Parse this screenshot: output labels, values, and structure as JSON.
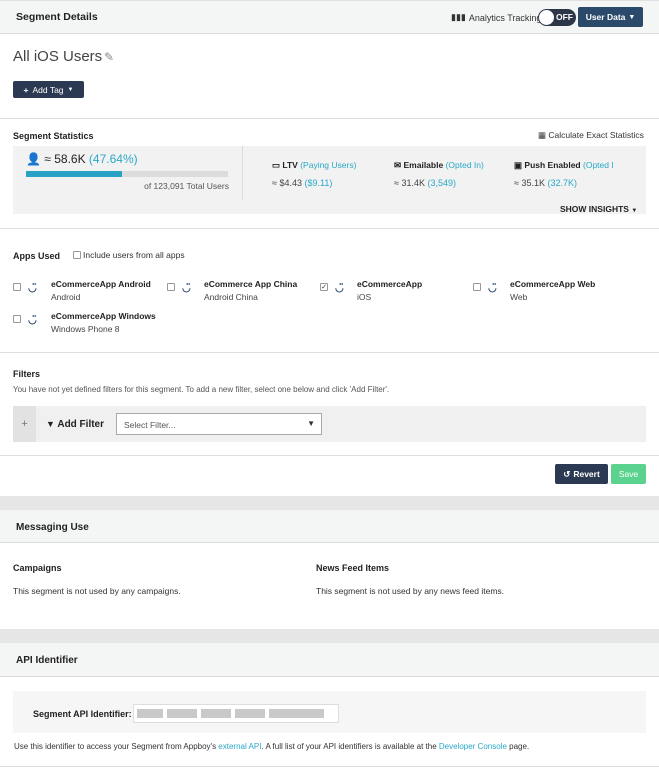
{
  "header": {
    "title": "Segment Details",
    "analytics_label": "Analytics Tracking",
    "toggle_label": "OFF",
    "user_data_label": "User Data"
  },
  "segment": {
    "name": "All iOS Users",
    "add_tag_label": "Add Tag"
  },
  "stats": {
    "title": "Segment Statistics",
    "calc_label": "Calculate Exact Statistics",
    "users_value": "≈ 58.6K",
    "users_pct": "(47.64%)",
    "users_fraction": 0.4764,
    "total_users": "of 123,091 Total Users",
    "metrics": [
      {
        "label": "LTV",
        "sub": "(Paying Users)",
        "value": "≈ $4.43",
        "value_sub": "($9.11)",
        "icon": "credit-card-icon"
      },
      {
        "label": "Emailable",
        "sub": "(Opted In)",
        "value": "≈ 31.4K",
        "value_sub": "(3,549)",
        "icon": "envelope-icon"
      },
      {
        "label": "Push Enabled",
        "sub": "(Opted I",
        "value": "≈ 35.1K",
        "value_sub": "(32.7K)",
        "icon": "push-icon"
      }
    ],
    "show_insights": "SHOW INSIGHTS"
  },
  "apps": {
    "title": "Apps Used",
    "include_all": "Include users from all apps",
    "items": [
      {
        "name": "eCommerceApp Android",
        "platform": "Android",
        "checked": false
      },
      {
        "name": "eCommerce App China",
        "platform": "Android China",
        "checked": false
      },
      {
        "name": "eCommerceApp",
        "platform": "iOS",
        "checked": true
      },
      {
        "name": "eCommerceApp Web",
        "platform": "Web",
        "checked": false
      },
      {
        "name": "eCommerceApp Windows",
        "platform": "Windows Phone 8",
        "checked": false
      }
    ]
  },
  "filters": {
    "title": "Filters",
    "description": "You have not yet defined filters for this segment. To add a new filter, select one below and click 'Add Filter'.",
    "add_filter": "Add Filter",
    "select_placeholder": "Select Filter..."
  },
  "actions": {
    "revert": "Revert",
    "save": "Save"
  },
  "messaging": {
    "title": "Messaging Use",
    "campaigns_title": "Campaigns",
    "campaigns_text": "This segment is not used by any campaigns.",
    "news_title": "News Feed Items",
    "news_text": "This segment is not used by any news feed items."
  },
  "api": {
    "title": "API Identifier",
    "label": "Segment API Identifier:",
    "note_pre": "Use this identifier to access your Segment from Appboy's ",
    "note_link1": "external API",
    "note_mid": ". A full list of your API identifiers is available at the ",
    "note_link2": "Developer Console",
    "note_post": " page."
  }
}
